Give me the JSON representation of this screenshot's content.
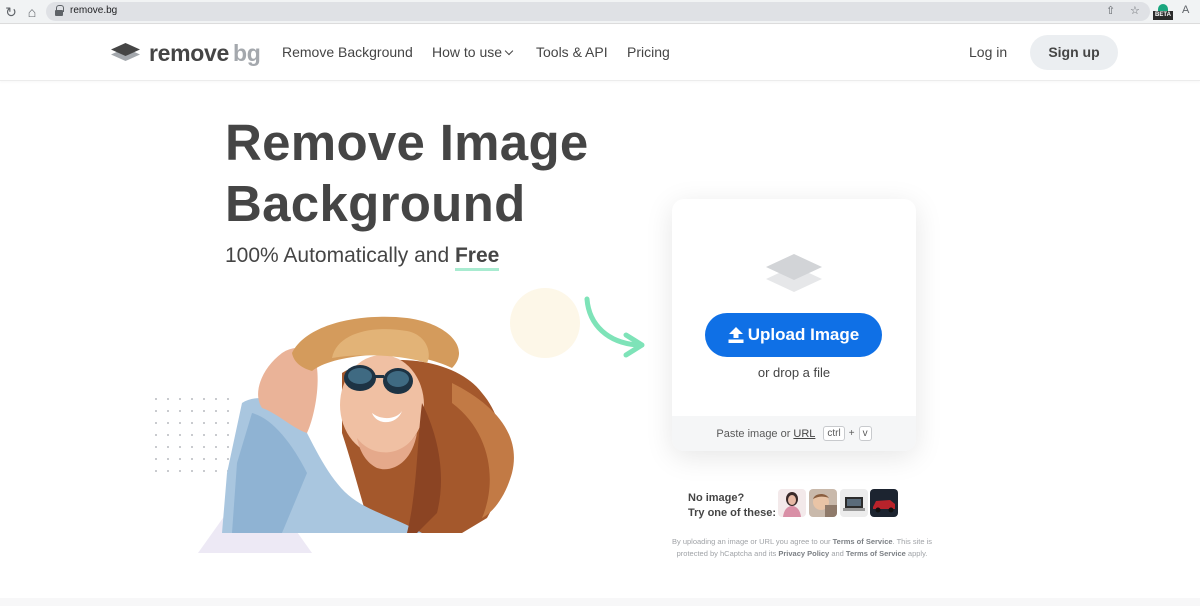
{
  "browser": {
    "url": "remove.bg",
    "badge": "BETA"
  },
  "header": {
    "logo_remove": "remove",
    "logo_bg": "bg",
    "nav": [
      "Remove Background",
      "How to use",
      "Tools & API",
      "Pricing"
    ],
    "login": "Log in",
    "signup": "Sign up"
  },
  "hero": {
    "title_line1": "Remove Image",
    "title_line2": "Background",
    "subtitle_prefix": "100% Automatically and ",
    "subtitle_free": "Free"
  },
  "upload": {
    "button": "Upload Image",
    "drop": "or drop a file",
    "paste_prefix": "Paste image or",
    "paste_url": "URL",
    "key_ctrl": "ctrl",
    "key_plus": "+",
    "key_v": "v"
  },
  "samples": {
    "line1": "No image?",
    "line2": "Try one of these:"
  },
  "legal": {
    "t1": "By uploading an image or URL you agree to our ",
    "tos1": "Terms of Service",
    "t2": ". This site is protected by hCaptcha and its ",
    "privacy": "Privacy Policy",
    "t3": " and ",
    "tos2": "Terms of Service",
    "t4": " apply."
  },
  "colors": {
    "accent": "#0f70e6",
    "brand_gray": "#454545",
    "mint": "#a8ebd0"
  }
}
